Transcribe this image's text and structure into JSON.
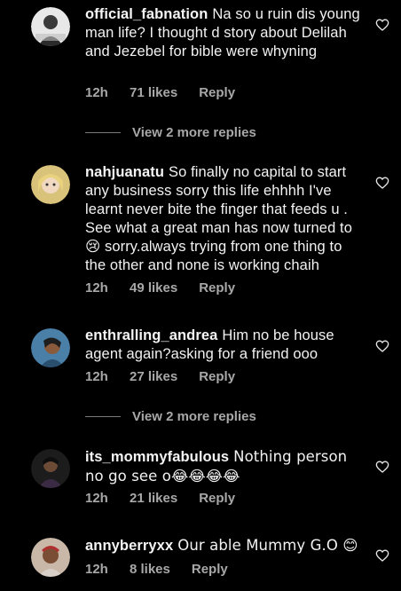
{
  "comments": [
    {
      "username": "official_fabnation",
      "text": "Na so u ruin dis young man life? I thought d story about Delilah and Jezebel for bible were whyning",
      "time": "12h",
      "likes": "71 likes",
      "reply": "Reply"
    },
    {
      "username": "nahjuanatu",
      "text": "So finally no capital to start any business sorry this life ehhhh I've learnt never bite the finger that feeds u . See what a great man has now turned to 😢 sorry.always trying from one thing to the other and none is working chaih",
      "time": "12h",
      "likes": "49 likes",
      "reply": "Reply"
    },
    {
      "username": "enthralling_andrea",
      "text": "Him no be house agent again?asking for a friend ooo",
      "time": "12h",
      "likes": "27 likes",
      "reply": "Reply"
    },
    {
      "username": "its_mommyfabulous",
      "text": "Nothing person no go see o😂😂😂😂",
      "time": "12h",
      "likes": "21 likes",
      "reply": "Reply"
    },
    {
      "username": "annyberryxx",
      "text": "Our able Mummy G.O 😊",
      "time": "12h",
      "likes": "8 likes",
      "reply": "Reply"
    }
  ],
  "view_more": [
    {
      "label": "View 2 more replies"
    },
    {
      "label": "View 2 more replies"
    }
  ],
  "icons": {
    "like": "heart-outline-icon",
    "avatar": "profile-avatar"
  },
  "colors": {
    "background": "#000000",
    "text": "#f2f2f2",
    "muted": "#a8a8a8"
  }
}
